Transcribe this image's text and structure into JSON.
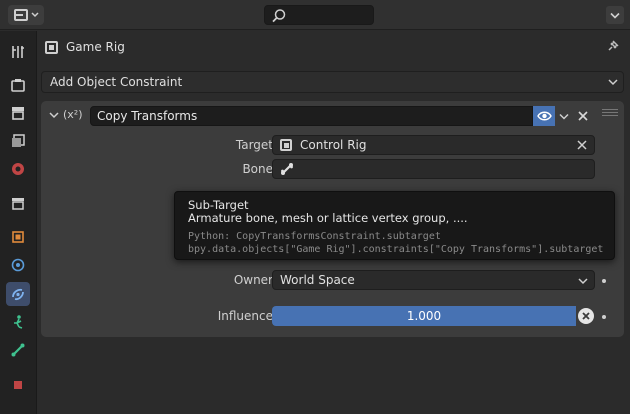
{
  "header": {
    "editor_type_icon": "properties-editor-icon",
    "search_icon": "search-icon",
    "search_placeholder": ""
  },
  "sidebar": {
    "tabs": [
      {
        "name": "tool",
        "icon": "tool-icon"
      },
      {
        "name": "render",
        "icon": "render-icon"
      },
      {
        "name": "output",
        "icon": "output-icon"
      },
      {
        "name": "view-layer",
        "icon": "view-layer-icon"
      },
      {
        "name": "scene",
        "icon": "scene-icon"
      },
      {
        "name": "collection",
        "icon": "collection-icon"
      },
      {
        "name": "object",
        "icon": "object-icon"
      },
      {
        "name": "modifiers",
        "icon": "physics-icon"
      },
      {
        "name": "object-constraint",
        "icon": "constraint-icon",
        "active": true
      },
      {
        "name": "object-data",
        "icon": "armature-icon"
      },
      {
        "name": "bone",
        "icon": "bone-icon"
      }
    ]
  },
  "object": {
    "name": "Game Rig"
  },
  "add_constraint_label": "Add Object Constraint",
  "constraint": {
    "type_icon_text": "(x²)",
    "name": "Copy Transforms",
    "target_label": "Target",
    "target_value": "Control Rig",
    "bone_label": "Bone",
    "bone_value": "",
    "owner_label": "Owner",
    "owner_value": "World Space",
    "influence_label": "Influence",
    "influence_value": "1.000"
  },
  "tooltip": {
    "title": "Sub-Target",
    "description": "Armature bone, mesh or lattice vertex group, ....",
    "python_line1": "Python: CopyTransformsConstraint.subtarget",
    "python_line2": "bpy.data.objects[\"Game Rig\"].constraints[\"Copy Transforms\"].subtarget"
  },
  "colors": {
    "accent": "#4772b3",
    "background": "#2b2b2b",
    "panel": "#3c3c3c",
    "tooltip_bg": "#181818"
  }
}
